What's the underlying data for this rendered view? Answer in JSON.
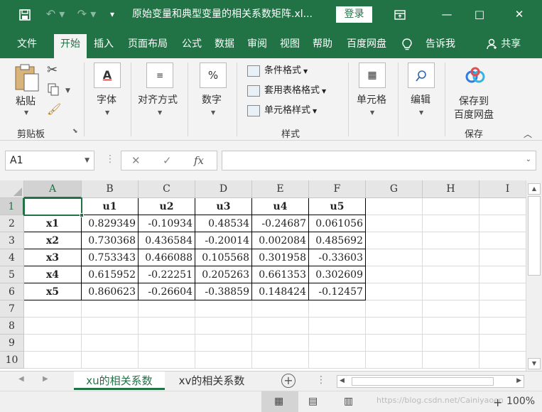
{
  "titlebar": {
    "save_icon": "save-icon",
    "title": "原始变量和典型变量的相关系数矩阵.xl...",
    "login_label": "登录",
    "minimize": "—",
    "restore": "□",
    "close": "✕"
  },
  "tabs": [
    "文件",
    "开始",
    "插入",
    "页面布局",
    "公式",
    "数据",
    "审阅",
    "视图",
    "帮助",
    "百度网盘",
    "告诉我",
    "共享"
  ],
  "ribbon": {
    "paste_label": "粘贴",
    "clipboard_label": "剪贴板",
    "font_label": "字体",
    "align_label": "对齐方式",
    "number_label": "数字",
    "cond_format_label": "条件格式",
    "table_format_label": "套用表格格式",
    "cell_style_label": "单元格样式",
    "styles_label": "样式",
    "cells_label": "单元格",
    "edit_label": "编辑",
    "save_baidu_line1": "保存到",
    "save_baidu_line2": "百度网盘",
    "save_label": "保存"
  },
  "formula_bar": {
    "name_box": "A1",
    "fx": "fx",
    "value": ""
  },
  "sheet": {
    "columns": [
      "A",
      "B",
      "C",
      "D",
      "E",
      "F",
      "G",
      "H",
      "I"
    ],
    "rows": [
      "1",
      "2",
      "3",
      "4",
      "5",
      "6",
      "7",
      "8",
      "9",
      "10"
    ],
    "header_row": [
      "",
      "u1",
      "u2",
      "u3",
      "u4",
      "u5"
    ],
    "data": [
      [
        "x1",
        "0.829349",
        "-0.10934",
        "0.48534",
        "-0.24687",
        "0.061056"
      ],
      [
        "x2",
        "0.730368",
        "0.436584",
        "-0.20014",
        "0.002084",
        "0.485692"
      ],
      [
        "x3",
        "0.753343",
        "0.466088",
        "0.105568",
        "0.301958",
        "-0.33603"
      ],
      [
        "x4",
        "0.615952",
        "-0.22251",
        "0.205263",
        "0.661353",
        "0.302609"
      ],
      [
        "x5",
        "0.860623",
        "-0.26604",
        "-0.38859",
        "0.148424",
        "-0.12457"
      ]
    ]
  },
  "sheet_tabs": [
    "xu的相关系数",
    "xv的相关系数"
  ],
  "status": {
    "zoom": "100%",
    "watermark": "https://blog.csdn.net/Cainiyaoen"
  },
  "colors": {
    "accent": "#217346"
  }
}
